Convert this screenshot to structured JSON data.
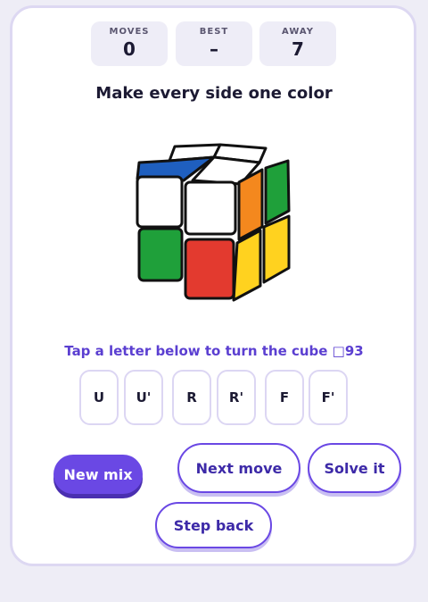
{
  "stats": [
    {
      "label": "MOVES",
      "value": "0"
    },
    {
      "label": "BEST",
      "value": "–"
    },
    {
      "label": "AWAY",
      "value": "7"
    }
  ],
  "title": "Make every side one color",
  "hint": "Tap a letter below to turn the cube □93",
  "cube": {
    "top_face": [
      "#ffffff",
      "#ffffff",
      "#1f5fbf",
      "#ffffff"
    ],
    "front_face": [
      "#ffffff",
      "#ffffff",
      "#1fa03a",
      "#e33a2f"
    ],
    "right_face": [
      "#1fa03a",
      "#f4881e",
      "#ffd21f",
      "#ffd21f"
    ],
    "colors": {
      "white": "#ffffff",
      "blue": "#1f5fbf",
      "green": "#1fa03a",
      "red": "#e33a2f",
      "orange": "#f4881e",
      "yellow": "#ffd21f"
    }
  },
  "move_buttons": [
    "U",
    "U'",
    "R",
    "R'",
    "F",
    "F'"
  ],
  "actions": {
    "new_mix": "New mix",
    "next_move": "Next move",
    "solve_it": "Solve it",
    "step_back": "Step back"
  },
  "accent": "#6a48e4"
}
